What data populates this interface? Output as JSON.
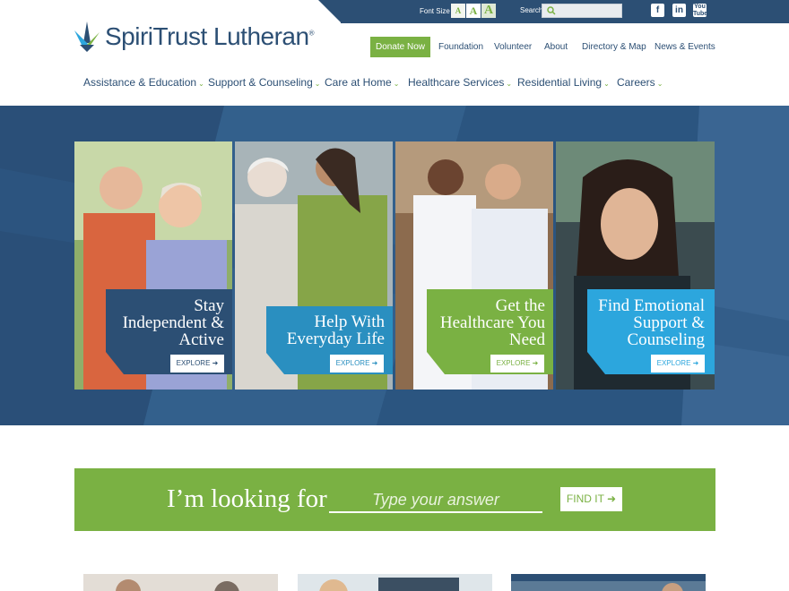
{
  "utility": {
    "font_size_label": "Font Size",
    "font_sizes": [
      "A",
      "A",
      "A"
    ],
    "search_label": "Search",
    "search_placeholder": "",
    "social": [
      "facebook-icon",
      "linkedin-icon",
      "youtube-icon"
    ]
  },
  "logo": {
    "name": "SpiriTrust Lutheran",
    "mark": "®"
  },
  "secondary_nav": {
    "donate": "Donate Now",
    "items": [
      "Foundation",
      "Volunteer",
      "About",
      "Directory & Map",
      "News & Events"
    ]
  },
  "main_nav": [
    "Assistance & Education",
    "Support & Counseling",
    "Care at Home",
    "Healthcare Services",
    "Residential Living",
    "Careers"
  ],
  "hero": {
    "panels": [
      {
        "lines": [
          "Stay",
          "Independent &",
          "Active"
        ],
        "button": "EXPLORE",
        "color": "#2c4f74"
      },
      {
        "lines": [
          "Help With",
          "Everyday Life"
        ],
        "button": "EXPLORE",
        "color": "#2a8fc0"
      },
      {
        "lines": [
          "Get the",
          "Healthcare You",
          "Need"
        ],
        "button": "EXPLORE",
        "color": "#7ab143"
      },
      {
        "lines": [
          "Find Emotional",
          "Support &",
          "Counseling"
        ],
        "button": "EXPLORE",
        "color": "#2ca6dd"
      }
    ]
  },
  "looking_for": {
    "label": "I’m looking for",
    "placeholder": "Type your answer",
    "button": "FIND IT"
  },
  "colors": {
    "navy": "#2c4f74",
    "green": "#7ab143",
    "blue": "#2a8fc0",
    "sky": "#2ca6dd"
  }
}
